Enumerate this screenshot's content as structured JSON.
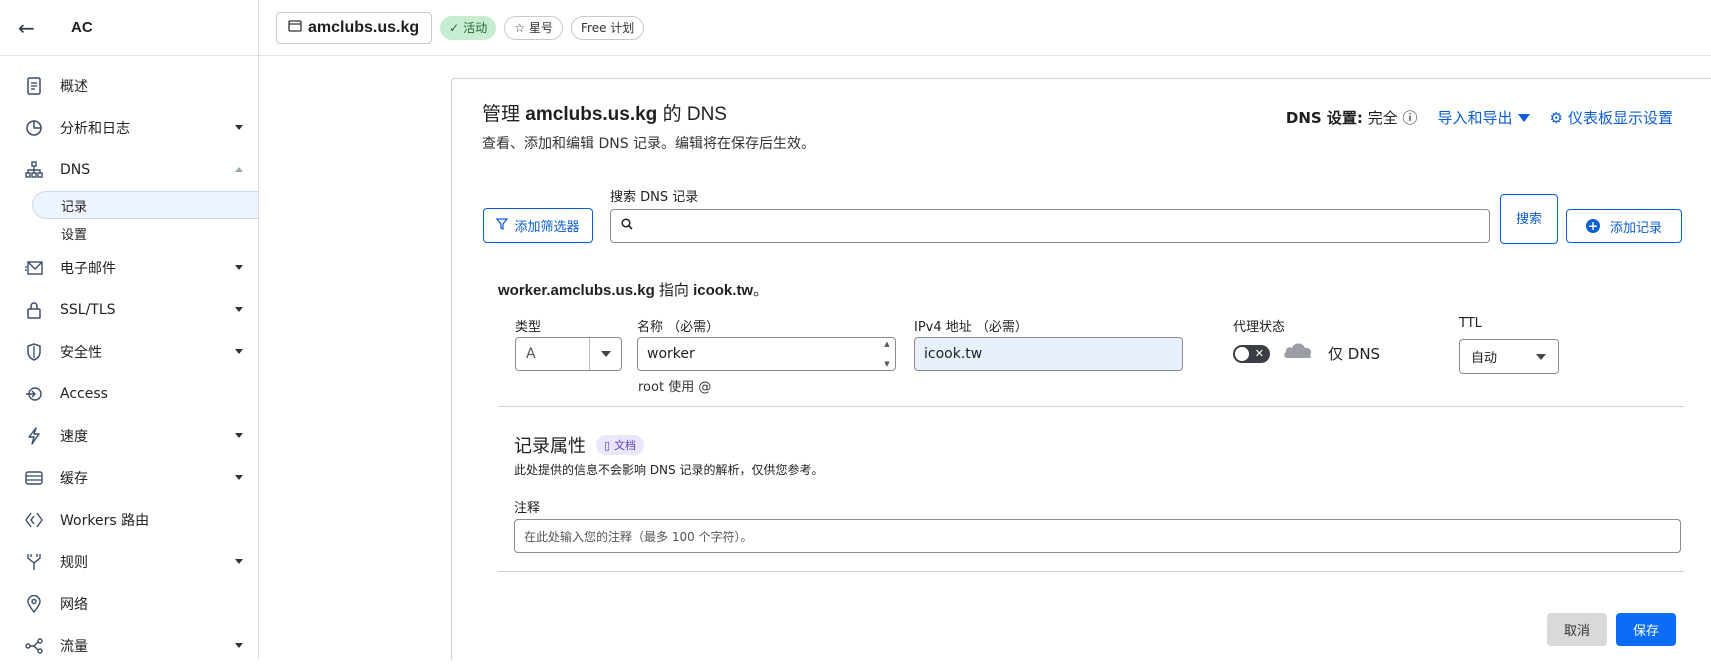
{
  "sidebar": {
    "account": "AC",
    "items": [
      {
        "label": "概述",
        "icon": "document-icon",
        "caret": false
      },
      {
        "label": "分析和日志",
        "icon": "pie-chart-icon",
        "caret": true
      },
      {
        "label": "DNS",
        "icon": "network-icon",
        "caret": "up"
      },
      {
        "label": "电子邮件",
        "icon": "mail-icon",
        "caret": true
      },
      {
        "label": "SSL/TLS",
        "icon": "lock-icon",
        "caret": true
      },
      {
        "label": "安全性",
        "icon": "shield-icon",
        "caret": true
      },
      {
        "label": "Access",
        "icon": "access-icon",
        "caret": false
      },
      {
        "label": "速度",
        "icon": "bolt-icon",
        "caret": true
      },
      {
        "label": "缓存",
        "icon": "cache-icon",
        "caret": true
      },
      {
        "label": "Workers 路由",
        "icon": "workers-icon",
        "caret": false
      },
      {
        "label": "规则",
        "icon": "rules-icon",
        "caret": true
      },
      {
        "label": "网络",
        "icon": "location-pin-icon",
        "caret": false
      },
      {
        "label": "流量",
        "icon": "traffic-icon",
        "caret": true
      }
    ],
    "dns_sub": [
      "记录",
      "设置"
    ]
  },
  "topbar": {
    "domain": "amclubs.us.kg",
    "status": "活动",
    "star": "星号",
    "plan": "Free 计划"
  },
  "card": {
    "title_prefix": "管理",
    "title_domain": "amclubs.us.kg",
    "title_suffix": "的 DNS",
    "subtitle": "查看、添加和编辑 DNS 记录。编辑将在保存后生效。",
    "dns_setting_label": "DNS 设置:",
    "dns_setting_value": "完全",
    "import_export": "导入和导出",
    "dashboard_settings": "仪表板显示设置"
  },
  "search": {
    "label": "搜索 DNS 记录",
    "filter_button": "添加筛选器",
    "search_button": "搜索",
    "add_button": "添加记录",
    "value": ""
  },
  "record": {
    "desc_name": "worker.amclubs.us.kg",
    "desc_mid": "指向",
    "desc_target": "icook.tw",
    "desc_end": "。",
    "type_label": "类型",
    "type_value": "A",
    "name_label": "名称 （必需）",
    "name_value": "worker",
    "name_hint": "root 使用 @",
    "ipv4_label": "IPv4 地址 （必需）",
    "ipv4_value": "icook.tw",
    "proxy_label": "代理状态",
    "proxy_enabled": false,
    "proxy_value": "仅 DNS",
    "ttl_label": "TTL",
    "ttl_value": "自动"
  },
  "attributes": {
    "title": "记录属性",
    "doc_badge": "文档",
    "desc": "此处提供的信息不会影响 DNS 记录的解析，仅供您参考。",
    "note_label": "注释",
    "note_placeholder": "在此处输入您的注释（最多 100 个字符）。"
  },
  "actions": {
    "cancel": "取消",
    "save": "保存"
  },
  "colors": {
    "accent": "#0b5ed7",
    "save": "#0b6cf5",
    "active_badge": "#c8ecd0",
    "autofill": "#e8f0fe"
  }
}
